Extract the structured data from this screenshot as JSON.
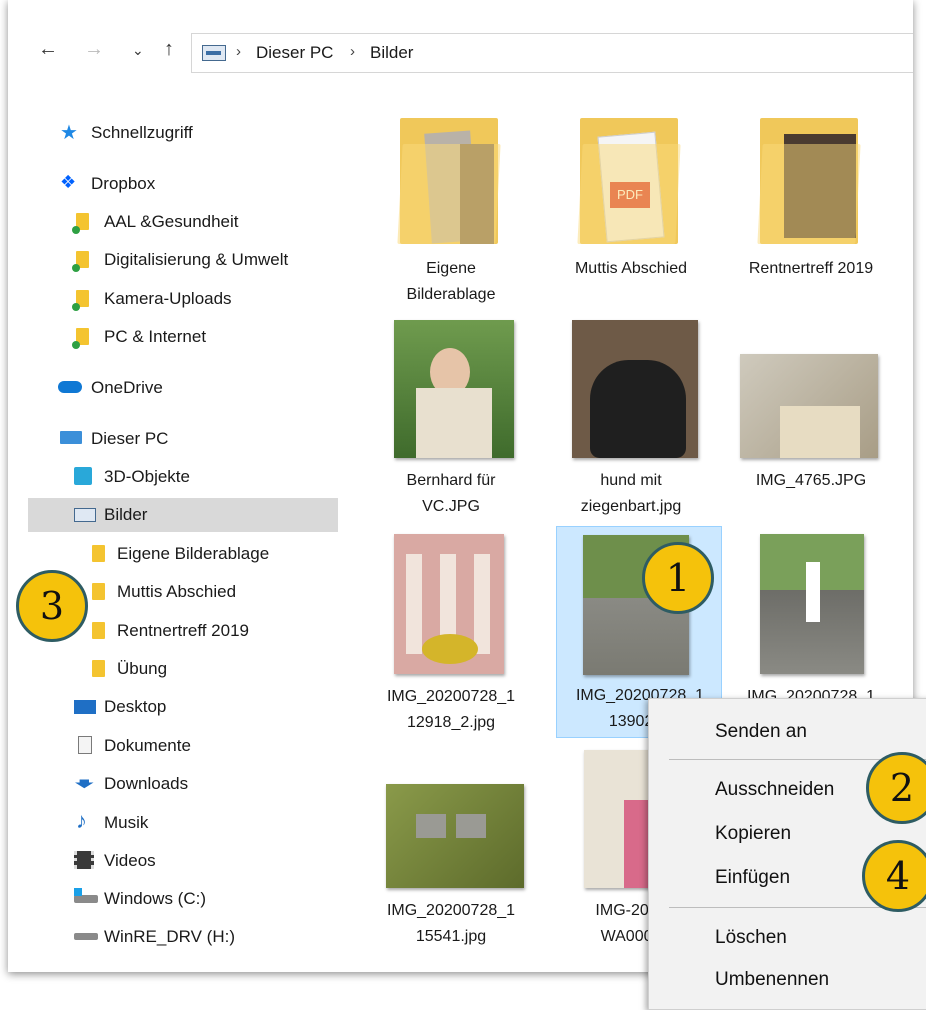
{
  "address": {
    "crumbs": [
      "Dieser PC",
      "Bilder"
    ]
  },
  "sidebar": {
    "items": [
      {
        "label": "Schnellzugriff",
        "icon": "star-icon"
      },
      {
        "label": "Dropbox",
        "icon": "dropbox-icon"
      },
      {
        "label": "AAL &Gesundheit",
        "icon": "folder-icon"
      },
      {
        "label": "Digitalisierung & Umwelt",
        "icon": "folder-icon"
      },
      {
        "label": "Kamera-Uploads",
        "icon": "folder-icon"
      },
      {
        "label": "PC & Internet",
        "icon": "folder-icon"
      },
      {
        "label": "OneDrive",
        "icon": "cloud-icon"
      },
      {
        "label": "Dieser PC",
        "icon": "computer-icon"
      },
      {
        "label": "3D-Objekte",
        "icon": "cube-icon"
      },
      {
        "label": "Bilder",
        "icon": "pictures-icon"
      },
      {
        "label": "Eigene Bilderablage",
        "icon": "folder-icon"
      },
      {
        "label": "Muttis Abschied",
        "icon": "folder-icon"
      },
      {
        "label": "Rentnertreff 2019",
        "icon": "folder-icon"
      },
      {
        "label": "Übung",
        "icon": "folder-icon"
      },
      {
        "label": "Desktop",
        "icon": "desktop-icon"
      },
      {
        "label": "Dokumente",
        "icon": "document-icon"
      },
      {
        "label": "Downloads",
        "icon": "download-icon"
      },
      {
        "label": "Musik",
        "icon": "music-icon"
      },
      {
        "label": "Videos",
        "icon": "video-icon"
      },
      {
        "label": "Windows (C:)",
        "icon": "drive-icon"
      },
      {
        "label": "WinRE_DRV (H:)",
        "icon": "drive-icon"
      }
    ]
  },
  "files": [
    {
      "line1": "Eigene",
      "line2": "Bilderablage"
    },
    {
      "line1": "Muttis Abschied",
      "line2": ""
    },
    {
      "line1": "Rentnertreff 2019",
      "line2": ""
    },
    {
      "line1": "Bernhard für",
      "line2": "VC.JPG"
    },
    {
      "line1": "hund mit",
      "line2": "ziegenbart.jpg"
    },
    {
      "line1": "IMG_4765.JPG",
      "line2": ""
    },
    {
      "line1": "IMG_20200728_1",
      "line2": "12918_2.jpg"
    },
    {
      "line1": "IMG_20200728_1",
      "line2": "13902_2"
    },
    {
      "line1": "IMG_20200728_1",
      "line2": ""
    },
    {
      "line1": "IMG_20200728_1",
      "line2": "15541.jpg"
    },
    {
      "line1": "IMG-2020",
      "line2": "WA0001"
    }
  ],
  "context_menu": {
    "items": [
      "Senden an",
      "Ausschneiden",
      "Kopieren",
      "Einfügen",
      "Löschen",
      "Umbenennen"
    ]
  },
  "badges": [
    "1",
    "2",
    "3",
    "4"
  ],
  "colors": {
    "badge": "#f5c20b",
    "badge_border": "#2e5c63",
    "selection": "#cce8ff",
    "sidebar_selected": "#d9d9d9",
    "folder": "#f4c430"
  }
}
